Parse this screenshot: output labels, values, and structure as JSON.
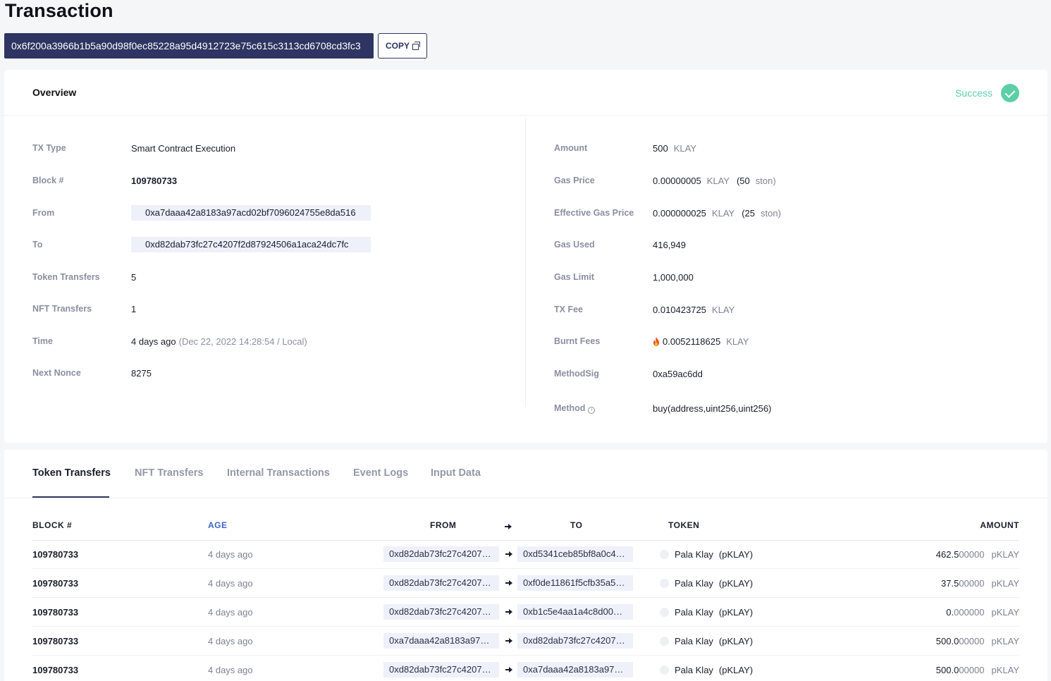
{
  "page": {
    "title": "Transaction"
  },
  "tx": {
    "hash": "0x6f200a3966b1b5a90d98f0ec85228a95d4912723e75c615c3113cd6708cd3fc3",
    "copy_label": "COPY"
  },
  "overview": {
    "title": "Overview",
    "status": "Success",
    "left": {
      "tx_type": {
        "label": "TX Type",
        "value": "Smart Contract Execution"
      },
      "block": {
        "label": "Block #",
        "value": "109780733"
      },
      "from": {
        "label": "From",
        "value": "0xa7daaa42a8183a97acd02bf7096024755e8da516"
      },
      "to": {
        "label": "To",
        "value": "0xd82dab73fc27c4207f2d87924506a1aca24dc7fc"
      },
      "token_transfers": {
        "label": "Token Transfers",
        "value": "5"
      },
      "nft_transfers": {
        "label": "NFT Transfers",
        "value": "1"
      },
      "time": {
        "label": "Time",
        "value": "4 days ago",
        "detail": "(Dec 22, 2022 14:28:54 / Local)"
      },
      "next_nonce": {
        "label": "Next Nonce",
        "value": "8275"
      }
    },
    "right": {
      "amount": {
        "label": "Amount",
        "value": "500",
        "unit": "KLAY"
      },
      "gas_price": {
        "label": "Gas Price",
        "value": "0.00000005",
        "unit": "KLAY",
        "paren_value": "(50",
        "paren_unit": "ston)"
      },
      "effective_gas_price": {
        "label": "Effective Gas Price",
        "value": "0.000000025",
        "unit": "KLAY",
        "paren_value": "(25",
        "paren_unit": "ston)"
      },
      "gas_used": {
        "label": "Gas Used",
        "value": "416,949"
      },
      "gas_limit": {
        "label": "Gas Limit",
        "value": "1,000,000"
      },
      "tx_fee": {
        "label": "TX Fee",
        "value": "0.010423725",
        "unit": "KLAY"
      },
      "burnt_fees": {
        "label": "Burnt Fees",
        "value": "0.0052118625",
        "unit": "KLAY"
      },
      "method_sig": {
        "label": "MethodSig",
        "value": "0xa59ac6dd"
      },
      "method": {
        "label": "Method",
        "value": "buy(address,uint256,uint256)"
      }
    }
  },
  "tabs": [
    "Token Transfers",
    "NFT Transfers",
    "Internal Transactions",
    "Event Logs",
    "Input Data"
  ],
  "table": {
    "headers": {
      "block": "BLOCK #",
      "age": "AGE",
      "from": "FROM",
      "to": "TO",
      "token": "TOKEN",
      "amount": "AMOUNT"
    },
    "rows": [
      {
        "block": "109780733",
        "age": "4 days ago",
        "from": "0xd82dab73fc27c4207f…",
        "to": "0xd5341ceb85bf8a0c4f…",
        "token": "Pala Klay",
        "symbol": "(pKLAY)",
        "amount_main": "462.5",
        "amount_dec": "00000",
        "unit": "pKLAY"
      },
      {
        "block": "109780733",
        "age": "4 days ago",
        "from": "0xd82dab73fc27c4207f…",
        "to": "0xf0de11861f5cfb35a5e…",
        "token": "Pala Klay",
        "symbol": "(pKLAY)",
        "amount_main": "37.5",
        "amount_dec": "00000",
        "unit": "pKLAY"
      },
      {
        "block": "109780733",
        "age": "4 days ago",
        "from": "0xd82dab73fc27c4207f…",
        "to": "0xb1c5e4aa1a4c8d00a6…",
        "token": "Pala Klay",
        "symbol": "(pKLAY)",
        "amount_main": "0.",
        "amount_dec": "000000",
        "unit": "pKLAY"
      },
      {
        "block": "109780733",
        "age": "4 days ago",
        "from": "0xa7daaa42a8183a97ac…",
        "to": "0xd82dab73fc27c4207f…",
        "token": "Pala Klay",
        "symbol": "(pKLAY)",
        "amount_main": "500.0",
        "amount_dec": "00000",
        "unit": "pKLAY"
      },
      {
        "block": "109780733",
        "age": "4 days ago",
        "from": "0xd82dab73fc27c4207f…",
        "to": "0xa7daaa42a8183a97ac…",
        "token": "Pala Klay",
        "symbol": "(pKLAY)",
        "amount_main": "500.0",
        "amount_dec": "00000",
        "unit": "pKLAY"
      }
    ]
  },
  "colors": {
    "primary": "#2e3562",
    "success": "#5ccfa6",
    "link": "#3e63c7"
  }
}
